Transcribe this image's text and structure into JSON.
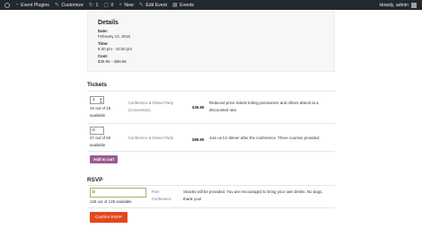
{
  "admin_bar": {
    "items": [
      {
        "icon": "speedometer-icon",
        "glyph": "◔",
        "label": "Event Plugins"
      },
      {
        "icon": "paintbrush-icon",
        "glyph": "✎",
        "label": "Customize"
      },
      {
        "icon": "update-icon",
        "glyph": "↻",
        "label": "1"
      },
      {
        "icon": "comment-icon",
        "glyph": "▢",
        "label": "0"
      },
      {
        "icon": "plus-icon",
        "glyph": "+",
        "label": "New"
      },
      {
        "icon": "pencil-icon",
        "glyph": "✎",
        "label": "Edit Event"
      },
      {
        "icon": "calendar-icon",
        "glyph": "▦",
        "label": "Events"
      }
    ],
    "greeting": "Howdy, admin"
  },
  "details": {
    "heading": "Details",
    "date_label": "Date:",
    "date_value": "February 12, 2016",
    "time_label": "Time:",
    "time_value": "6:30 pm - 10:30 pm",
    "cost_label": "Cost:",
    "cost_value": "$36.95 – $99.95"
  },
  "tickets": {
    "heading": "Tickets",
    "rows": [
      {
        "quantity": "1",
        "availability": "16 out of 16 available",
        "name": "Conference & Dinner Party (Concession)",
        "price": "$36.95",
        "description": "Reduced price tickets letting pensioners and others attend at a discounted rate."
      },
      {
        "quantity": "0",
        "availability": "47 out of 50 available",
        "name": "Conference & Dinner Party",
        "price": "$99.95",
        "description": "Join us for dinner after the conference. Three courses provided."
      }
    ],
    "add_to_cart_label": "Add to cart"
  },
  "rsvp": {
    "heading": "RSVP",
    "quantity": "0",
    "availability": "125 out of 125 available",
    "name": "Free Conference",
    "description": "Snacks will be provided. You are encouraged to bring your own drinks. No dogs, thank you!",
    "confirm_label": "Confirm RSVP"
  }
}
